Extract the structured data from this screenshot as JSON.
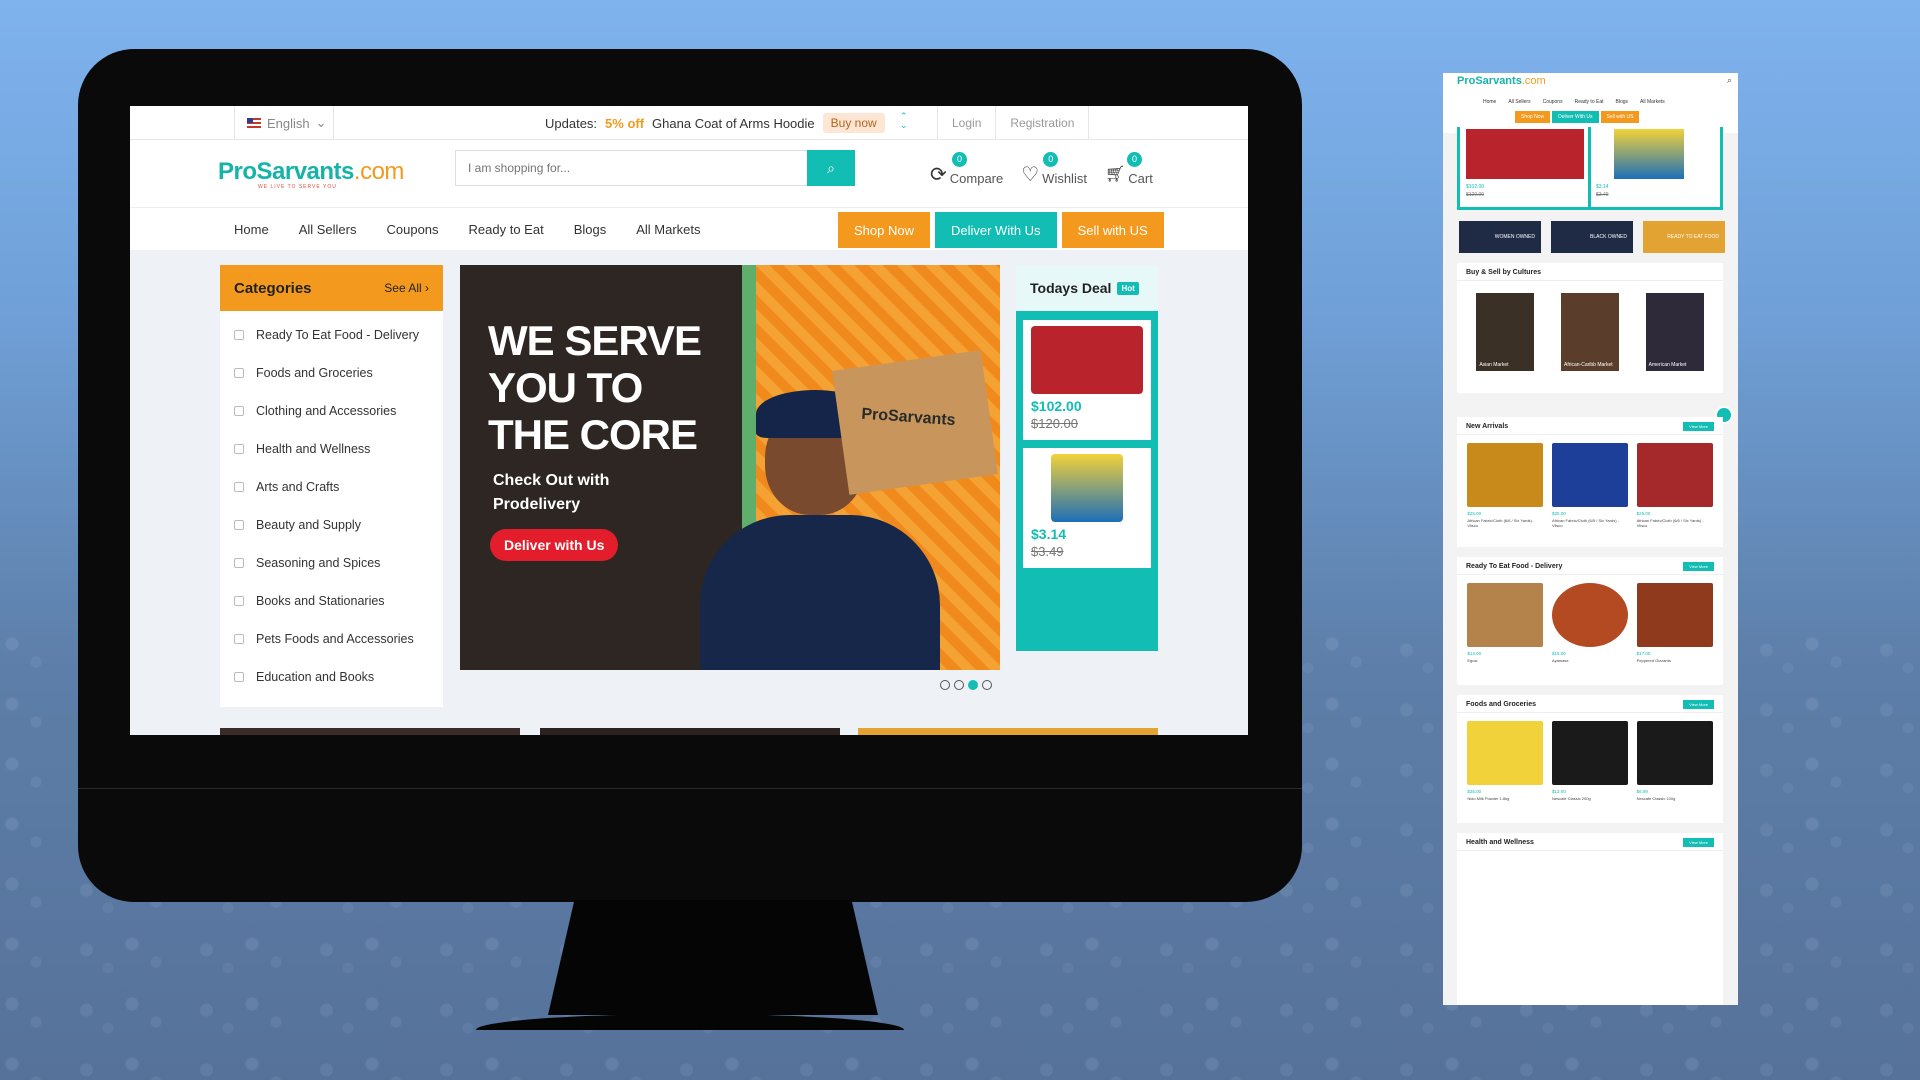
{
  "topbar": {
    "language": "English",
    "updates_label": "Updates:",
    "promo_pct": "5% off",
    "promo_text": "Ghana Coat of Arms Hoodie",
    "buy_now": "Buy now",
    "login": "Login",
    "registration": "Registration"
  },
  "header": {
    "logo_main": "ProSarvants",
    "logo_dot": ".com",
    "logo_tagline": "WE LIVE TO SERVE YOU",
    "search_placeholder": "I am shopping for...",
    "icons": [
      {
        "label": "Compare",
        "count": "0",
        "icon": "refresh-icon"
      },
      {
        "label": "Wishlist",
        "count": "0",
        "icon": "heart-icon"
      },
      {
        "label": "Cart",
        "count": "0",
        "icon": "cart-icon"
      }
    ]
  },
  "nav": {
    "links": [
      "Home",
      "All Sellers",
      "Coupons",
      "Ready to Eat",
      "Blogs",
      "All Markets"
    ],
    "shop_now": "Shop Now",
    "deliver_with_us": "Deliver With Us",
    "sell_with_us": "Sell with US"
  },
  "categories": {
    "title": "Categories",
    "see_all": "See All ›",
    "items": [
      "Ready To Eat Food - Delivery",
      "Foods and Groceries",
      "Clothing and Accessories",
      "Health and Wellness",
      "Arts and Crafts",
      "Beauty and Supply",
      "Seasoning and Spices",
      "Books and Stationaries",
      "Pets Foods and Accessories",
      "Education and Books"
    ]
  },
  "banner": {
    "headline_1": "WE SERVE",
    "headline_2": "YOU TO",
    "headline_3": "THE CORE",
    "sub": "Check Out with Prodelivery",
    "cta": "Deliver with Us",
    "box_text": "ProSarvants",
    "active_slide": 3,
    "slides": 4
  },
  "deal": {
    "title": "Todays Deal",
    "badge": "Hot",
    "items": [
      {
        "price": "$102.00",
        "old": "$120.00"
      },
      {
        "price": "$3.14",
        "old": "$3.49"
      }
    ]
  },
  "mobile": {
    "logo_main": "ProSarvants",
    "logo_dot": ".com",
    "nav": [
      "Home",
      "All Sellers",
      "Coupons",
      "Ready to Eat",
      "Blogs",
      "All Markets"
    ],
    "btns": [
      "Shop Now",
      "Deliver With Us",
      "Sell with US"
    ],
    "deal_prices": [
      "$102.00",
      "$120.00",
      "$3.14",
      "$3.49"
    ],
    "culture_tiles": [
      "WOMEN OWNED",
      "BLACK OWNED",
      "READY TO EAT FOOD"
    ],
    "cultures_title": "Buy & Sell by Cultures",
    "cultures": [
      "Asian Market",
      "African-Caribb Market",
      "American Market"
    ],
    "new_arrivals_title": "New Arrivals",
    "view_more": "View More",
    "new_arrivals": [
      {
        "price": "$25.00",
        "name": "African Fabric/Cloth (6/6 / Six Yards) - Vlisco"
      },
      {
        "price": "$25.00",
        "name": "African Fabric/Cloth (6/5 / Six Yards) - Vlisco"
      },
      {
        "price": "$25.00",
        "name": "African Fabric/Cloth (6/6 / Six Yards) - Vlisco"
      }
    ],
    "ready_title": "Ready To Eat Food - Delivery",
    "ready": [
      {
        "price": "$13.00",
        "name": "Egusi"
      },
      {
        "price": "$15.00",
        "name": "Ayamase"
      },
      {
        "price": "$17.00",
        "name": "Peppered Gizzards"
      }
    ],
    "foods_title": "Foods and Groceries",
    "foods": [
      {
        "price": "$35.00",
        "name": "Nido Milk Powder 1.8kg"
      },
      {
        "price": "$13.00",
        "name": "Nescafe Classic 200g"
      },
      {
        "price": "$6.99",
        "name": "Nescafe Classic 100g"
      }
    ],
    "health_title": "Health and Wellness"
  }
}
